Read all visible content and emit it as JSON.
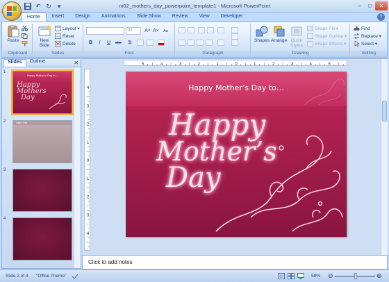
{
  "window": {
    "title": "m02_mothers_day_powerpoint_template1 - Microsoft PowerPoint",
    "min": "–",
    "max": "□",
    "close": "✕"
  },
  "qat": {
    "save": "💾",
    "undo": "↶",
    "redo": "↻",
    "more": "▾"
  },
  "tabs": [
    "Home",
    "Insert",
    "Design",
    "Animations",
    "Slide Show",
    "Review",
    "View",
    "Developer"
  ],
  "help": "?",
  "ribbon": {
    "clipboard": {
      "label": "Clipboard",
      "paste": "Paste"
    },
    "slides": {
      "label": "Slides",
      "new_slide": "New Slide",
      "layout": "Layout ▾",
      "reset": "Reset",
      "delete": "Delete"
    },
    "font": {
      "label": "Font",
      "font_size": "32",
      "bold": "B",
      "italic": "I",
      "underline": "U",
      "strike": "abc",
      "shadow": "S",
      "grow": "A˄",
      "shrink": "A˅",
      "clear": "Aa"
    },
    "paragraph": {
      "label": "Paragraph"
    },
    "drawing": {
      "label": "Drawing",
      "shapes": "Shapes",
      "arrange": "Arrange",
      "quick_styles": "Quick Styles",
      "shape_fill": "Shape Fill ▾",
      "shape_outline": "Shape Outline ▾",
      "shape_effects": "Shape Effects ▾"
    },
    "editing": {
      "label": "Editing",
      "find": "Find",
      "replace": "Replace ▾",
      "select": "Select ▾"
    }
  },
  "left_panel": {
    "tabs": [
      "Slides",
      "Outline"
    ],
    "close": "✕",
    "slides": [
      {
        "num": "1",
        "title": "Happy Mother's Day to...",
        "script_text": [
          "Happy",
          "Mothers",
          "Day"
        ]
      },
      {
        "num": "2",
        "title": "Insert Title",
        "script_text": []
      },
      {
        "num": "3",
        "title": "",
        "script_text": []
      },
      {
        "num": "4",
        "title": "",
        "script_text": []
      }
    ]
  },
  "slide": {
    "title": "Happy Mother’s Day to…",
    "script_line1": "Happy",
    "script_line2": "Mother’s",
    "script_line3": "Day"
  },
  "ruler": {
    "h_ticks": [
      "5",
      "4",
      "3",
      "2",
      "1",
      "0",
      "1",
      "2",
      "3",
      "4",
      "5"
    ],
    "v_ticks": [
      "4",
      "3",
      "2",
      "1",
      "0",
      "1",
      "2",
      "3",
      "4"
    ]
  },
  "notes": {
    "placeholder": "Click to add notes"
  },
  "status": {
    "slide_pos": "Slide 2 of 4",
    "theme": "\"Office Theme\"",
    "zoom": "58%"
  },
  "colors": {
    "slide_top": "#c92d5f",
    "slide_bottom": "#8a1540",
    "ribbon_bg": "#dbe8f9",
    "selection": "#f4b44a"
  }
}
